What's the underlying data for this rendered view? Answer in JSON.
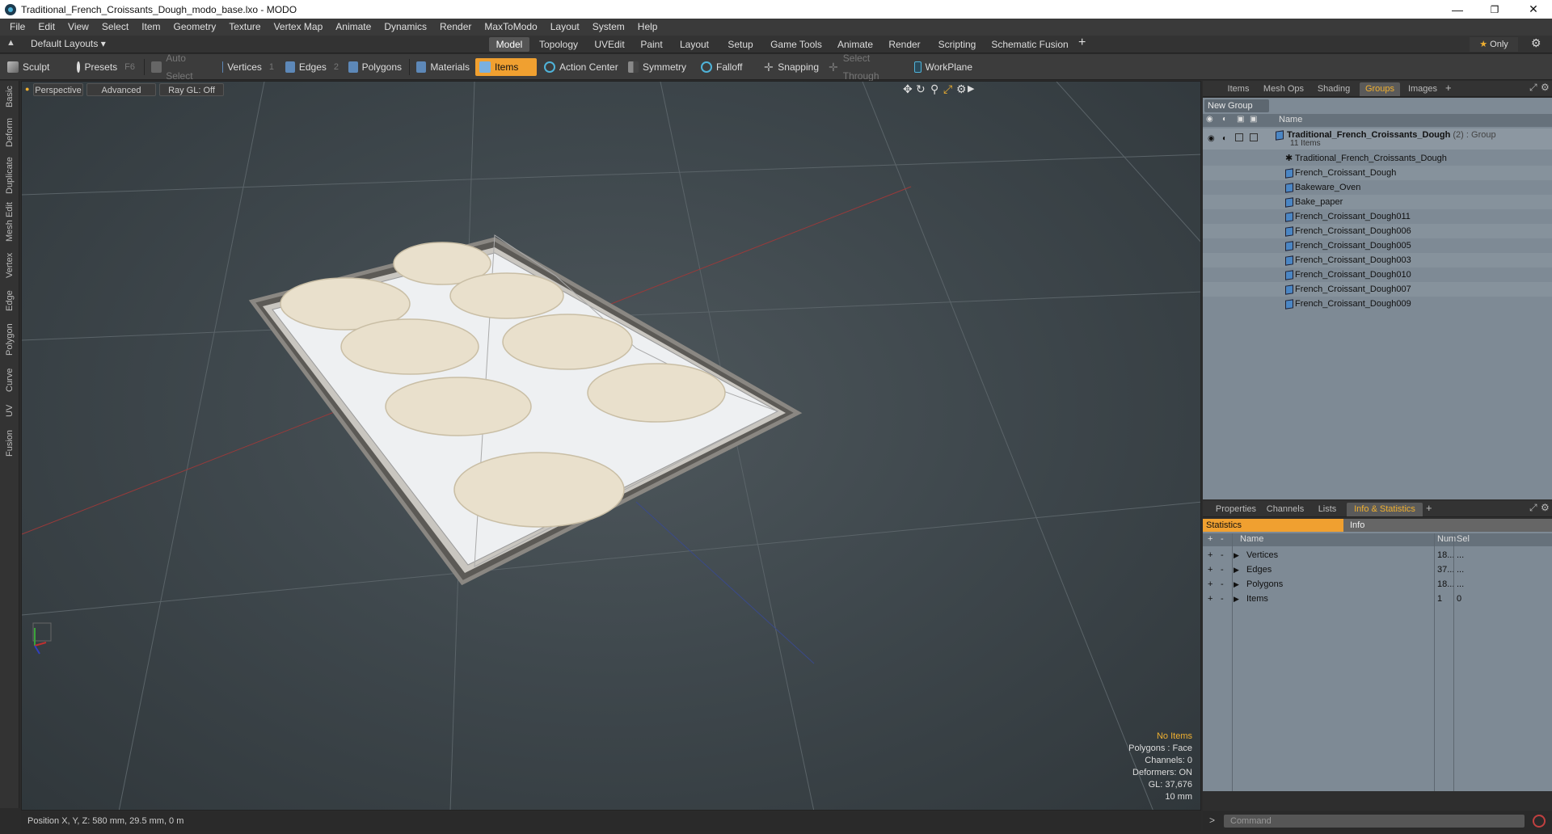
{
  "window": {
    "title": "Traditional_French_Croissants_Dough_modo_base.lxo - MODO"
  },
  "menu": [
    "File",
    "Edit",
    "View",
    "Select",
    "Item",
    "Geometry",
    "Texture",
    "Vertex Map",
    "Animate",
    "Dynamics",
    "Render",
    "MaxToModo",
    "Layout",
    "System",
    "Help"
  ],
  "layout": {
    "preset": "Default Layouts",
    "tabs": [
      "Model",
      "Topology",
      "UVEdit",
      "Paint",
      "Layout",
      "Setup",
      "Game Tools",
      "Animate",
      "Render",
      "Scripting",
      "Schematic Fusion"
    ],
    "active_tab": "Model",
    "only_label": "Only"
  },
  "toolbar": {
    "sculpt": "Sculpt",
    "presets": "Presets",
    "presets_key": "F6",
    "auto_select": "Auto Select",
    "vertices": "Vertices",
    "vertices_key": "1",
    "edges": "Edges",
    "edges_key": "2",
    "polygons": "Polygons",
    "materials": "Materials",
    "items": "Items",
    "action_center": "Action Center",
    "symmetry": "Symmetry",
    "falloff": "Falloff",
    "snapping": "Snapping",
    "select_through": "Select Through",
    "workplane": "WorkPlane"
  },
  "left_tabs": [
    "Basic",
    "Deform",
    "Duplicate",
    "Mesh Edit",
    "Vertex",
    "Edge",
    "Polygon",
    "Curve",
    "UV",
    "Fusion"
  ],
  "viewport": {
    "view": "Perspective",
    "shading": "Advanced",
    "raygl": "Ray GL: Off",
    "info": {
      "selection": "No Items",
      "polygons": "Polygons : Face",
      "channels": "Channels: 0",
      "deformers": "Deformers: ON",
      "gl": "GL: 37,676",
      "scale": "10 mm"
    }
  },
  "groups_panel": {
    "tabs": [
      "Items",
      "Mesh Ops",
      "Shading",
      "Groups",
      "Images"
    ],
    "active": "Groups",
    "new_group": "New Group",
    "col_name": "Name",
    "group_name": "Traditional_French_Croissants_Dough",
    "group_count": "(2)",
    "group_type": ": Group",
    "group_items": "11 Items",
    "items": [
      "Traditional_French_Croissants_Dough",
      "French_Croissant_Dough",
      "Bakeware_Oven",
      "Bake_paper",
      "French_Croissant_Dough011",
      "French_Croissant_Dough006",
      "French_Croissant_Dough005",
      "French_Croissant_Dough003",
      "French_Croissant_Dough010",
      "French_Croissant_Dough007",
      "French_Croissant_Dough009"
    ]
  },
  "stats_panel": {
    "tabs": [
      "Properties",
      "Channels",
      "Lists",
      "Info & Statistics"
    ],
    "active": "Info & Statistics",
    "subtabs": [
      "Statistics",
      "Info"
    ],
    "columns": {
      "name": "Name",
      "num": "Num",
      "sel": "Sel"
    },
    "rows": [
      {
        "name": "Vertices",
        "num": "18...",
        "sel": "..."
      },
      {
        "name": "Edges",
        "num": "37...",
        "sel": "..."
      },
      {
        "name": "Polygons",
        "num": "18...",
        "sel": "..."
      },
      {
        "name": "Items",
        "num": "1",
        "sel": "0"
      }
    ]
  },
  "status": {
    "position": "Position X, Y, Z:   580 mm, 29.5 mm, 0 m"
  },
  "command": {
    "placeholder": "Command"
  },
  "colors": {
    "accent": "#f0a030",
    "panel": "#7e8a95"
  }
}
